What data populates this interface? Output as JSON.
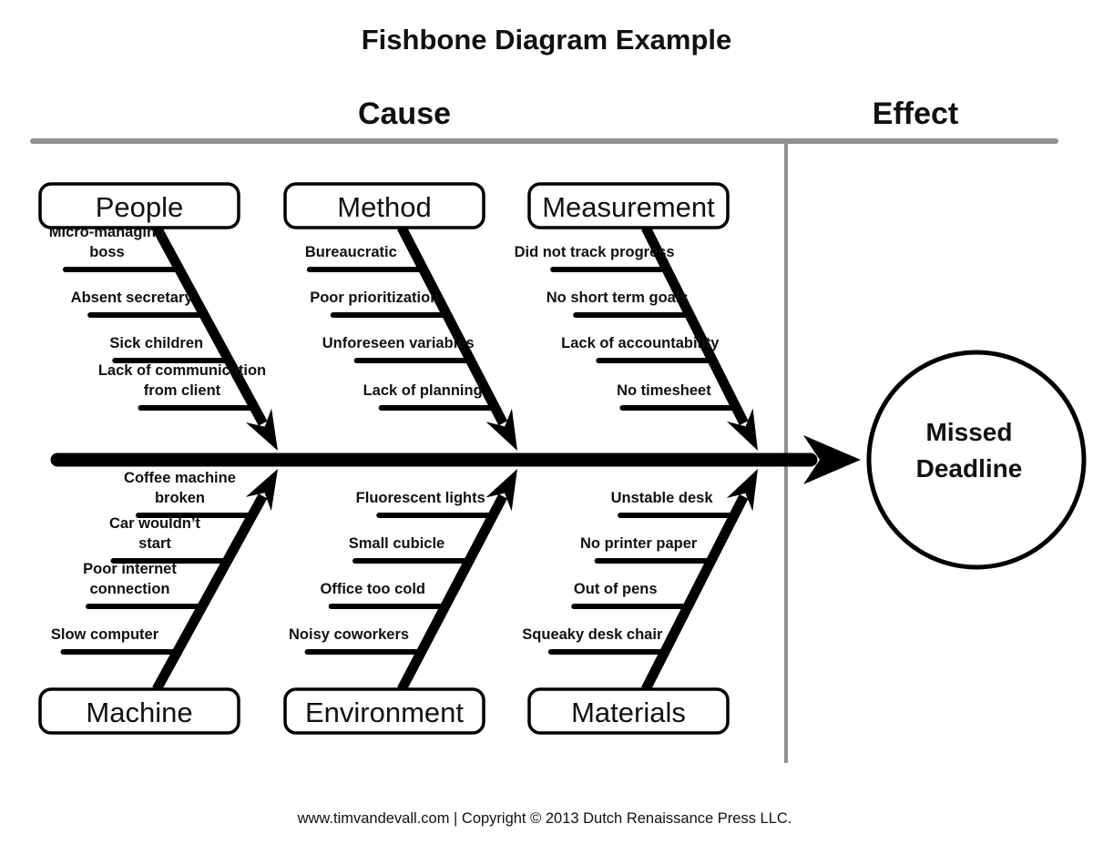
{
  "title": "Fishbone Diagram Example",
  "headers": {
    "cause": "Cause",
    "effect": "Effect"
  },
  "effect": {
    "lines": [
      "Missed",
      "Deadline"
    ]
  },
  "categories": [
    {
      "label": "People",
      "position": "top",
      "causes": [
        [
          "Micro-managing",
          "boss"
        ],
        [
          "Absent secretary"
        ],
        [
          "Sick children"
        ],
        [
          "Lack of communication",
          "from client"
        ]
      ]
    },
    {
      "label": "Method",
      "position": "top",
      "causes": [
        [
          "Bureaucratic"
        ],
        [
          "Poor prioritization"
        ],
        [
          "Unforeseen variables"
        ],
        [
          "Lack of planning"
        ]
      ]
    },
    {
      "label": "Measurement",
      "position": "top",
      "causes": [
        [
          "Did not track progress"
        ],
        [
          "No short term goals"
        ],
        [
          "Lack of accountability"
        ],
        [
          "No timesheet"
        ]
      ]
    },
    {
      "label": "Machine",
      "position": "bottom",
      "causes": [
        [
          "Coffee machine",
          "broken"
        ],
        [
          "Car wouldn’t",
          "start"
        ],
        [
          "Poor internet",
          "connection"
        ],
        [
          "Slow computer"
        ]
      ]
    },
    {
      "label": "Environment",
      "position": "bottom",
      "causes": [
        [
          "Fluorescent lights"
        ],
        [
          "Small cubicle"
        ],
        [
          "Office too cold"
        ],
        [
          "Noisy coworkers"
        ]
      ]
    },
    {
      "label": "Materials",
      "position": "bottom",
      "causes": [
        [
          "Unstable desk"
        ],
        [
          "No printer paper"
        ],
        [
          "Out of pens"
        ],
        [
          "Squeaky desk chair"
        ]
      ]
    }
  ],
  "footer": "www.timvandevall.com | Copyright © 2013 Dutch Renaissance Press LLC.",
  "colors": {
    "ink": "#000000",
    "divider": "#909090",
    "background": "#ffffff"
  }
}
